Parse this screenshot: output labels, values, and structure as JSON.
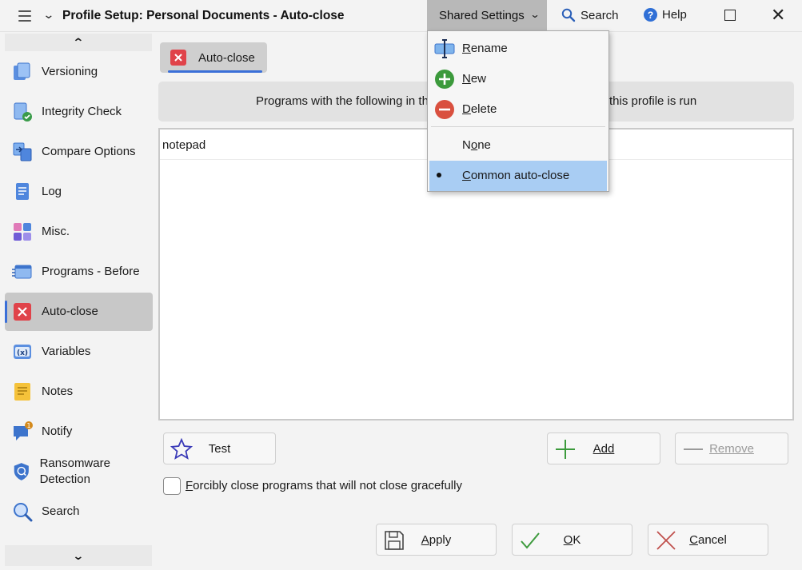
{
  "window": {
    "title": "Profile Setup: Personal Documents - Auto-close",
    "shared_settings": "Shared Settings",
    "search": "Search",
    "help": "Help"
  },
  "sidebar": {
    "items": [
      {
        "label": "Versioning",
        "icon": "versioning-icon"
      },
      {
        "label": "Integrity Check",
        "icon": "integrity-check-icon"
      },
      {
        "label": "Compare Options",
        "icon": "compare-options-icon"
      },
      {
        "label": "Log",
        "icon": "log-icon"
      },
      {
        "label": "Misc.",
        "icon": "misc-icon"
      },
      {
        "label": "Programs - Before",
        "icon": "programs-before-icon"
      },
      {
        "label": "Auto-close",
        "icon": "auto-close-icon"
      },
      {
        "label": "Variables",
        "icon": "variables-icon"
      },
      {
        "label": "Notes",
        "icon": "notes-icon"
      },
      {
        "label": "Notify",
        "icon": "notify-icon"
      },
      {
        "label": "Ransomware Detection",
        "icon": "ransomware-detection-icon"
      },
      {
        "label": "Search",
        "icon": "search-icon"
      }
    ],
    "notify_badge": "1"
  },
  "main": {
    "tab_label": "Auto-close",
    "banner_left": "Programs with the following in th",
    "banner_right": "this profile is run",
    "list_items": [
      "notepad"
    ],
    "test_label": "Test",
    "add_label": "Add",
    "remove_label": "Remove",
    "force_close_label": "orcibly close programs that will not close gracefully",
    "force_close_accel": "F",
    "apply_label": "pply",
    "apply_accel": "A",
    "ok_label": "K",
    "ok_accel": "O",
    "cancel_label": "ancel",
    "cancel_accel": "C"
  },
  "menu": {
    "rename": {
      "accel": "R",
      "rest": "ename"
    },
    "new": {
      "accel": "N",
      "rest": "ew"
    },
    "delete": {
      "accel": "D",
      "rest": "elete"
    },
    "none": {
      "pre": "N",
      "accel": "o",
      "rest": "ne"
    },
    "common": {
      "pre": "",
      "accel": "C",
      "rest": "ommon auto-close"
    }
  },
  "colors": {
    "accent": "#3a6fd8",
    "selected_menu": "#a9cdf3",
    "auto_close_red": "#e0434a",
    "add_green": "#3c9a3c"
  }
}
